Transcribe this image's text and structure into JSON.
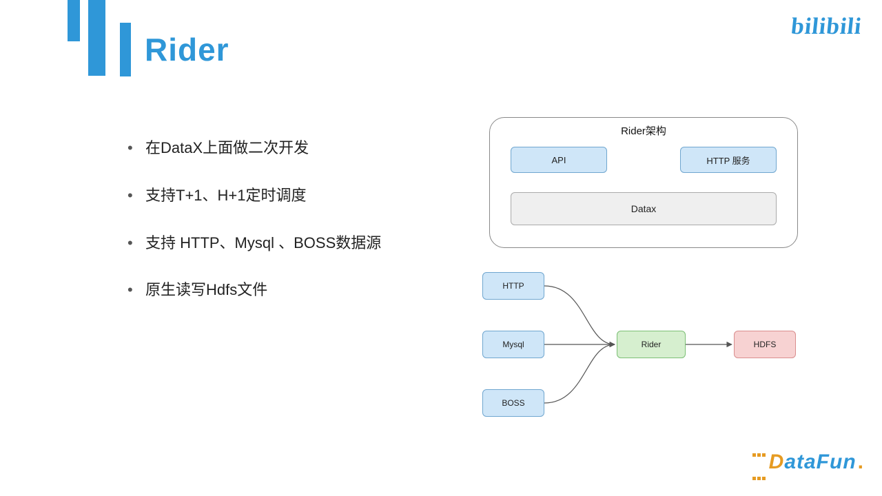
{
  "title": "Rider",
  "logos": {
    "bilibili_text": "bilibili",
    "datafun_text_d": "D",
    "datafun_text_rest": "ataFun",
    "datafun_dot": "."
  },
  "bullets": [
    "在DataX上面做二次开发",
    "支持T+1、H+1定时调度",
    "支持 HTTP、Mysql 、BOSS数据源",
    "原生读写Hdfs文件"
  ],
  "architecture": {
    "title": "Rider架构",
    "top_nodes": [
      "API",
      "HTTP 服务"
    ],
    "bottom_node": "Datax"
  },
  "flow": {
    "sources": [
      "HTTP",
      "Mysql",
      "BOSS"
    ],
    "middle": "Rider",
    "sink": "HDFS"
  },
  "colors": {
    "accent_blue": "#2f97d8",
    "node_blue_bg": "#cfe6f8",
    "node_gray_bg": "#efefef",
    "node_green_bg": "#d6efcf",
    "node_red_bg": "#f7d2d2",
    "datafun_orange": "#e69b22"
  }
}
